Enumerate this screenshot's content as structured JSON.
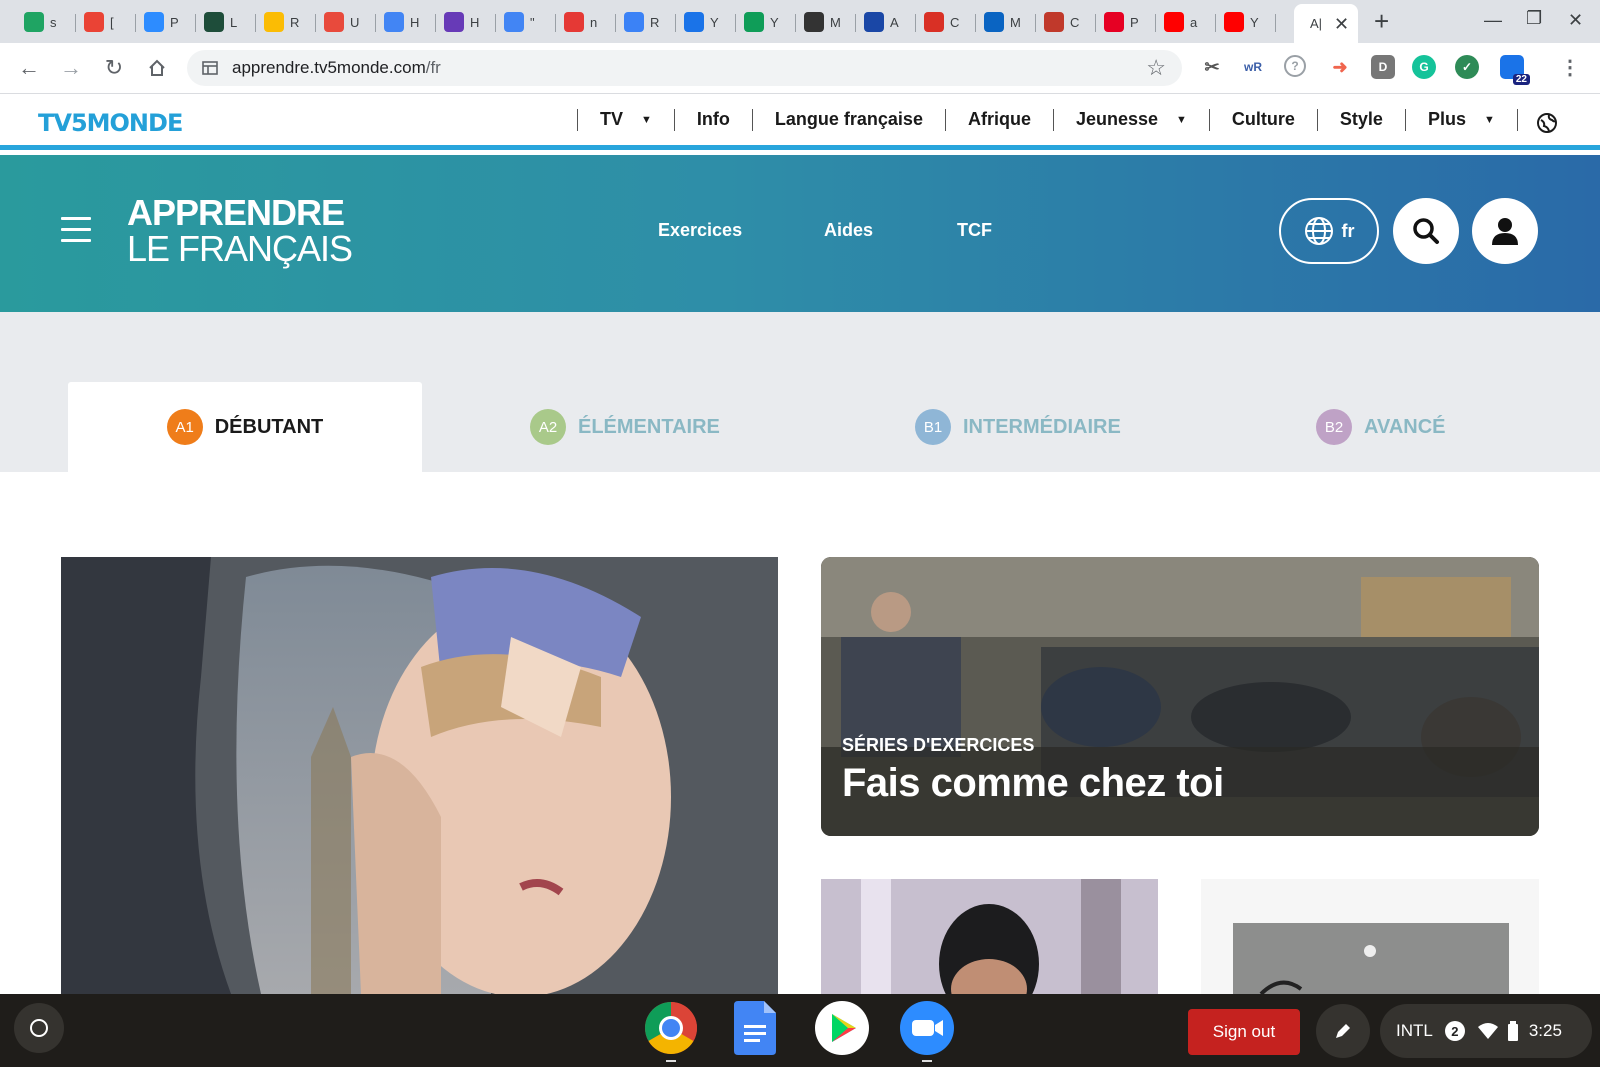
{
  "browser": {
    "tabs": [
      {
        "letter": "s",
        "icon": "google-drive-icon",
        "color": "#1fa463"
      },
      {
        "letter": "[",
        "icon": "gmail-icon",
        "color": "#ea4335"
      },
      {
        "letter": "P",
        "icon": "zoom-icon",
        "color": "#2d8cff"
      },
      {
        "letter": "L",
        "icon": "ses-icon",
        "color": "#1e4d3a"
      },
      {
        "letter": "R",
        "icon": "google-drive-icon",
        "color": "#fbbc04"
      },
      {
        "letter": "U",
        "icon": "circle-app-icon",
        "color": "#e84a3c"
      },
      {
        "letter": "H",
        "icon": "google-docs-icon",
        "color": "#4285f4"
      },
      {
        "letter": "H",
        "icon": "google-forms-icon",
        "color": "#673ab7"
      },
      {
        "letter": "\"",
        "icon": "google-docs-icon",
        "color": "#4285f4"
      },
      {
        "letter": "n",
        "icon": "app-icon",
        "color": "#e53935"
      },
      {
        "letter": "R",
        "icon": "chat-icon",
        "color": "#3b82f6"
      },
      {
        "letter": "Y",
        "icon": "contacts-icon",
        "color": "#1a73e8"
      },
      {
        "letter": "Y",
        "icon": "classroom-icon",
        "color": "#0f9d58"
      },
      {
        "letter": "M",
        "icon": "quilt-icon",
        "color": "#333333"
      },
      {
        "letter": "A",
        "icon": "a-icon",
        "color": "#1a47a6"
      },
      {
        "letter": "C",
        "icon": "puzzle-icon",
        "color": "#d93025"
      },
      {
        "letter": "M",
        "icon": "outlook-icon",
        "color": "#0a64c2"
      },
      {
        "letter": "C",
        "icon": "shield-app-icon",
        "color": "#c0392b"
      },
      {
        "letter": "P",
        "icon": "pinterest-icon",
        "color": "#e60023"
      },
      {
        "letter": "a",
        "icon": "youtube-icon",
        "color": "#ff0000"
      },
      {
        "letter": "Y",
        "icon": "youtube-icon",
        "color": "#ff0000"
      }
    ],
    "active_tab_label": "A|",
    "url_host": "apprendre.tv5monde.com",
    "url_path": "/fr",
    "ext_d_label": "D",
    "ext_badge": "22",
    "ext_wr_label": "wR"
  },
  "tv5": {
    "logo": "TV5MONDE",
    "nav": [
      {
        "label": "TV",
        "dropdown": true
      },
      {
        "label": "Info",
        "dropdown": false
      },
      {
        "label": "Langue française",
        "dropdown": false
      },
      {
        "label": "Afrique",
        "dropdown": false
      },
      {
        "label": "Jeunesse",
        "dropdown": true
      },
      {
        "label": "Culture",
        "dropdown": false
      },
      {
        "label": "Style",
        "dropdown": false
      },
      {
        "label": "Plus",
        "dropdown": true
      }
    ]
  },
  "apprendre": {
    "logo_line1": "APPRENDRE",
    "logo_line2": "LE FRANÇAIS",
    "nav": [
      "Exercices",
      "Aides",
      "TCF"
    ],
    "lang": "fr"
  },
  "levels": [
    {
      "badge": "A1",
      "label": "DÉBUTANT",
      "badge_color": "#ef7d1a",
      "text_color": "#1a1a1a",
      "active": true
    },
    {
      "badge": "A2",
      "label": "ÉLÉMENTAIRE",
      "badge_color": "#a9c98a",
      "text_color": "#8ab8c4",
      "active": false
    },
    {
      "badge": "B1",
      "label": "INTERMÉDIAIRE",
      "badge_color": "#8fb6d6",
      "text_color": "#8ab8c4",
      "active": false
    },
    {
      "badge": "B2",
      "label": "AVANCÉ",
      "badge_color": "#bfa2c6",
      "text_color": "#8ab8c4",
      "active": false
    }
  ],
  "featured": {
    "kicker": "SÉRIES D'EXERCICES",
    "title": "Fais comme chez toi"
  },
  "shelf": {
    "apps": [
      "chrome-icon",
      "google-docs-icon",
      "play-store-icon",
      "zoom-icon"
    ],
    "sign_out": "Sign out",
    "input_method": "INTL",
    "notifications": "2",
    "time": "3:25"
  }
}
